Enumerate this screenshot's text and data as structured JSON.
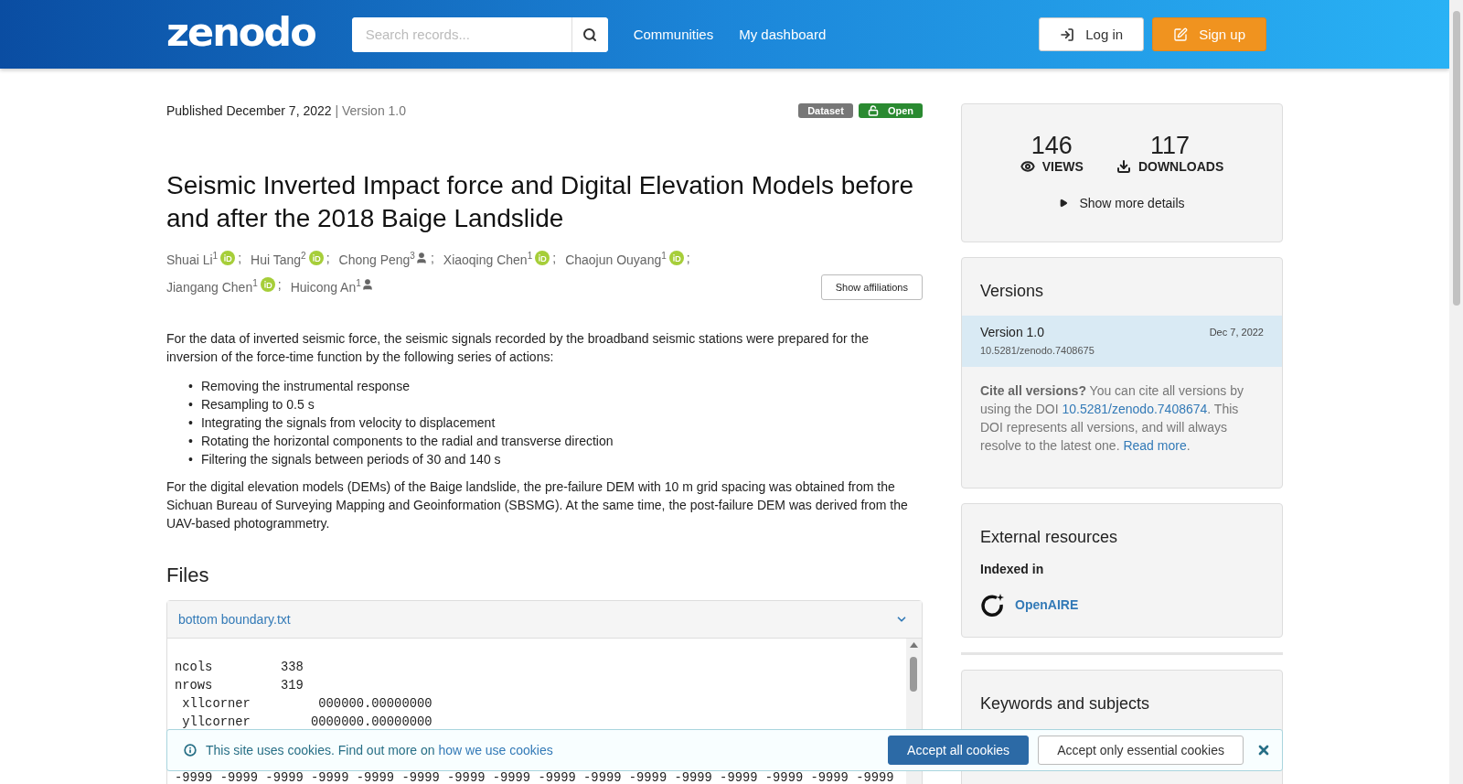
{
  "header": {
    "logo": "zenodo",
    "search": {
      "placeholder": "Search records..."
    },
    "nav": [
      "Communities",
      "My dashboard"
    ],
    "login": "Log in",
    "signup": "Sign up"
  },
  "record": {
    "published": "Published December 7, 2022",
    "version": "| Version 1.0",
    "badges": [
      {
        "kind": "type",
        "label": "Dataset"
      },
      {
        "kind": "access",
        "label": "Open"
      }
    ],
    "title": "Seismic Inverted Impact force and Digital Elevation Models before and after the 2018 Baige Landslide",
    "creators": [
      {
        "name": "Shuai Li$^{1}$",
        "kind": "orcid",
        "suffix": ";"
      },
      {
        "name": "Hui Tang$^{2}$",
        "kind": "orcid",
        "suffix": ";"
      },
      {
        "name": "Chong Peng$^{3}$",
        "kind": "person",
        "suffix": ";"
      },
      {
        "name": "Xiaoqing Chen$^{1}$",
        "kind": "orcid",
        "suffix": ";"
      },
      {
        "name": "Chaojun Ouyang$^{1}$",
        "kind": "orcid",
        "suffix": ";"
      },
      {
        "name": "Jiangang Chen$^{1}$",
        "kind": "orcid",
        "suffix": ";"
      },
      {
        "name": "Huicong An$^{1}$",
        "kind": "person"
      }
    ],
    "show_affiliations": "Show affiliations",
    "description": {
      "intro": "For the data of inverted seismic force, the seismic signals recorded by the broadband seismic stations were prepared for the inversion of the force-time function by the following series of actions:",
      "steps": [
        {
          "marker": "•",
          "text": "Removing the instrumental response"
        },
        {
          "marker": "•",
          "text": "Resampling to 0.5 s"
        },
        {
          "marker": "•",
          "text": "Integrating the signals from velocity to displacement"
        },
        {
          "marker": "•",
          "text": "Rotating the horizontal components to the radial and transverse direction"
        },
        {
          "marker": "•",
          "text": "Filtering the signals between periods of 30 and 140 s"
        }
      ],
      "outro": "For the digital elevation models (DEMs) of the Baige landslide, the pre-failure DEM with 10 m grid spacing was obtained from the Sichuan Bureau of Surveying Mapping and Geoinformation (SBSMG). At the same time, the post-failure DEM was derived from the UAV-based photogrammetry."
    },
    "files": {
      "heading": "Files",
      "file": {
        "name": "bottom boundary.txt",
        "expanded": true,
        "lines": [
          "ncols         338",
          "nrows         319",
          " xllcorner         000000.00000000",
          " yllcorner        0000000.00000000"
        ],
        "last_line": "-9999 -9999 -9999 -9999 -9999 -9999 -9999 -9999 -9999 -9999 -9999 -9999 -9999 -9999 -9999 -9999"
      }
    }
  },
  "sidebar": {
    "stats": [
      {
        "kind": "views",
        "value": "146",
        "label": "VIEWS"
      },
      {
        "kind": "downloads",
        "value": "117",
        "label": "DOWNLOADS"
      }
    ],
    "more_details": "Show more details",
    "versions": {
      "heading": "Versions",
      "items": [
        {
          "label": "Version 1.0",
          "date": "Dec 7, 2022",
          "doi": "10.5281/zenodo.7408675",
          "selected": true
        }
      ],
      "cite_lead": "Cite all versions?",
      "cite_text": " You can cite all versions by using the DOI ",
      "doi_link": "10.5281/zenodo.7408674",
      "cite_text_2": ". This DOI represents all versions, and will always resolve to the latest one. ",
      "read_more": "Read more",
      "cite_end": "."
    },
    "external": {
      "heading": "External resources",
      "subheading": "Indexed in",
      "link": "OpenAIRE"
    },
    "keywords": {
      "heading": "Keywords and subjects"
    }
  },
  "cookie_banner": {
    "text": "This site uses cookies. Find out more on ",
    "link": "how we use cookies",
    "accept_all": "Accept all cookies",
    "accept_essential": "Accept only essential cookies"
  }
}
